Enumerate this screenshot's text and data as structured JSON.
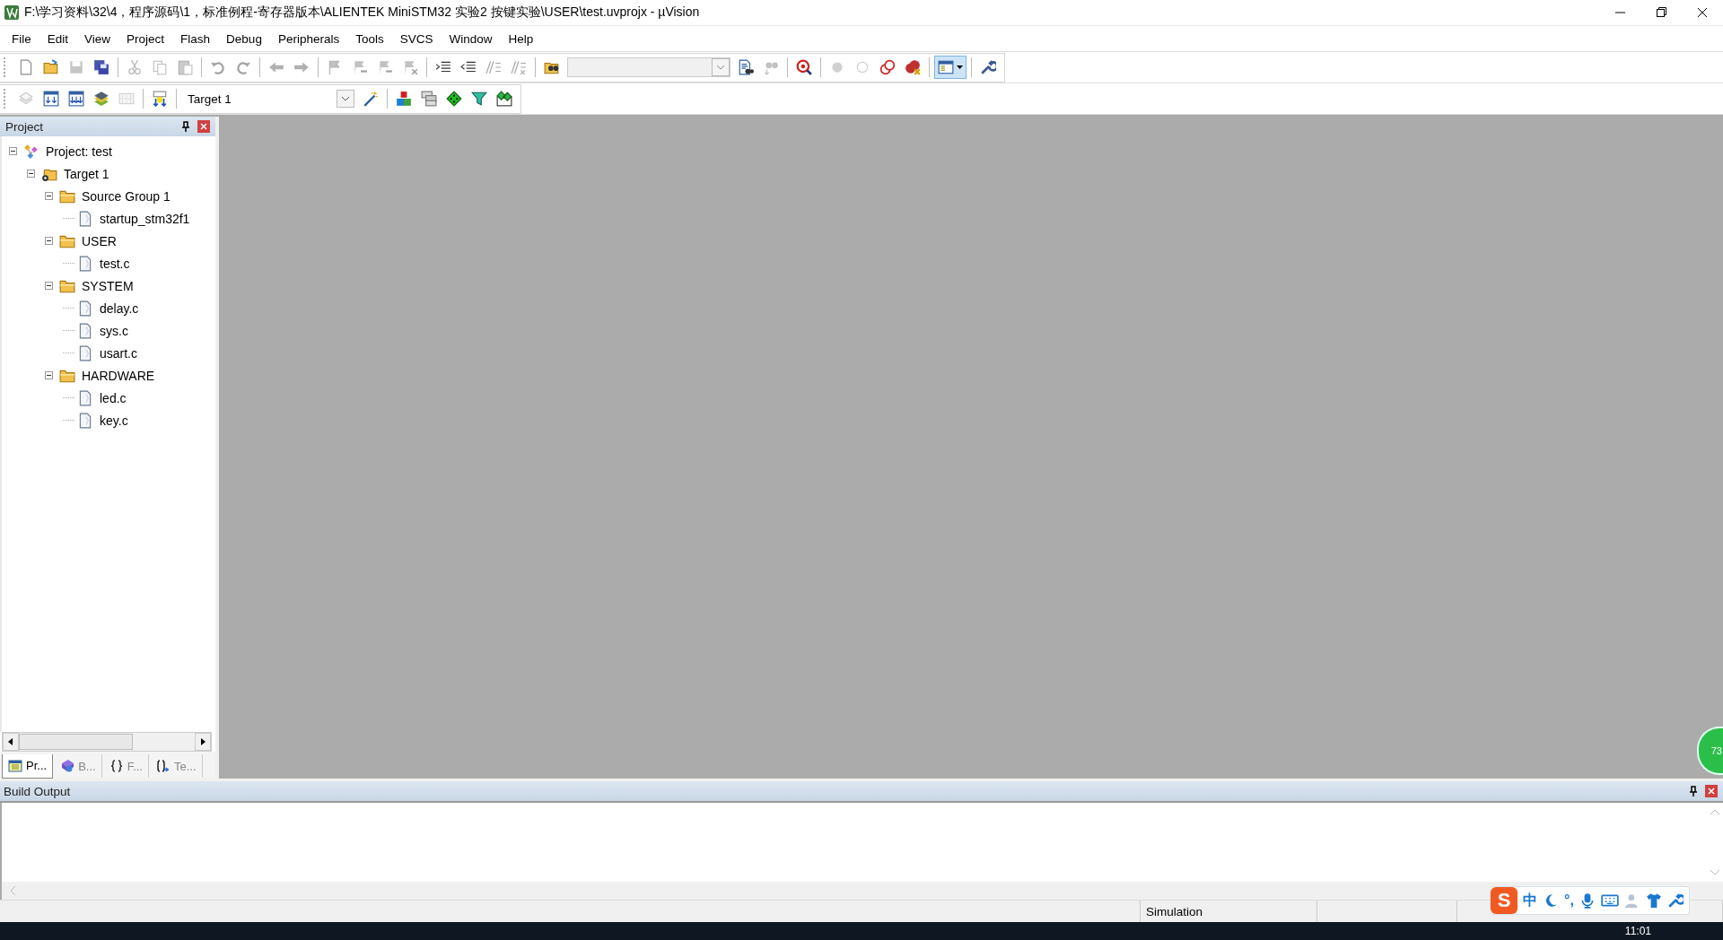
{
  "window": {
    "title": "F:\\学习资料\\32\\4，程序源码\\1，标准例程-寄存器版本\\ALIENTEK MiniSTM32 实验2  按键实验\\USER\\test.uvprojx - µVision"
  },
  "menu": [
    "File",
    "Edit",
    "View",
    "Project",
    "Flash",
    "Debug",
    "Peripherals",
    "Tools",
    "SVCS",
    "Window",
    "Help"
  ],
  "toolbar_1": [
    {
      "kind": "new",
      "disabled": false,
      "pressed": false
    },
    {
      "kind": "open",
      "disabled": false,
      "pressed": false
    },
    {
      "kind": "save",
      "disabled": true,
      "pressed": false
    },
    {
      "kind": "save-all",
      "disabled": false,
      "pressed": false
    },
    {
      "kind": "separator"
    },
    {
      "kind": "cut",
      "disabled": true,
      "pressed": false
    },
    {
      "kind": "copy",
      "disabled": true,
      "pressed": false
    },
    {
      "kind": "paste",
      "disabled": true,
      "pressed": false
    },
    {
      "kind": "separator"
    },
    {
      "kind": "undo",
      "disabled": true,
      "pressed": false
    },
    {
      "kind": "redo",
      "disabled": true,
      "pressed": false
    },
    {
      "kind": "separator"
    },
    {
      "kind": "back",
      "disabled": true,
      "pressed": false
    },
    {
      "kind": "forward",
      "disabled": true,
      "pressed": false
    },
    {
      "kind": "separator"
    },
    {
      "kind": "flag",
      "disabled": true,
      "pressed": false
    },
    {
      "kind": "flag-prev",
      "disabled": true,
      "pressed": false
    },
    {
      "kind": "flag-next",
      "disabled": true,
      "pressed": false
    },
    {
      "kind": "flag-clear",
      "disabled": true,
      "pressed": false
    },
    {
      "kind": "separator"
    },
    {
      "kind": "indent",
      "disabled": false,
      "pressed": false
    },
    {
      "kind": "unindent",
      "disabled": false,
      "pressed": false
    },
    {
      "kind": "comment",
      "disabled": true,
      "pressed": false
    },
    {
      "kind": "uncomment",
      "disabled": true,
      "pressed": false
    },
    {
      "kind": "separator"
    },
    {
      "kind": "find-in-files",
      "disabled": false,
      "pressed": false
    },
    {
      "kind": "combo",
      "disabled": true
    },
    {
      "kind": "find",
      "disabled": false,
      "pressed": false
    },
    {
      "kind": "incremental-find",
      "disabled": true,
      "pressed": false
    },
    {
      "kind": "separator"
    },
    {
      "kind": "debug",
      "disabled": false,
      "pressed": false
    },
    {
      "kind": "separator"
    },
    {
      "kind": "breakpoint",
      "disabled": true,
      "pressed": false
    },
    {
      "kind": "breakpoint-enable",
      "disabled": true,
      "pressed": false
    },
    {
      "kind": "breakpoint-disable-all",
      "disabled": false,
      "pressed": false
    },
    {
      "kind": "breakpoint-kill-all",
      "disabled": false,
      "pressed": false
    },
    {
      "kind": "separator"
    },
    {
      "kind": "window-layout",
      "disabled": false,
      "pressed": true
    },
    {
      "kind": "separator"
    },
    {
      "kind": "wrench",
      "disabled": false,
      "pressed": false
    }
  ],
  "toolbar_2": [
    {
      "kind": "translate",
      "disabled": true
    },
    {
      "kind": "build",
      "disabled": false
    },
    {
      "kind": "rebuild",
      "disabled": false
    },
    {
      "kind": "batch-build",
      "disabled": false
    },
    {
      "kind": "stop",
      "disabled": true
    },
    {
      "kind": "separator"
    },
    {
      "kind": "download",
      "disabled": false
    },
    {
      "kind": "separator"
    },
    {
      "kind": "combo",
      "value": "Target 1",
      "disabled": false
    },
    {
      "kind": "options",
      "disabled": false
    },
    {
      "kind": "separator"
    },
    {
      "kind": "components",
      "disabled": false
    },
    {
      "kind": "environment",
      "disabled": false
    },
    {
      "kind": "diamond",
      "disabled": false
    },
    {
      "kind": "funnel",
      "disabled": false
    },
    {
      "kind": "pack",
      "disabled": false
    }
  ],
  "project_panel": {
    "title": "Project",
    "tree": [
      {
        "label": "Project: test",
        "kind": "project",
        "expanded": true,
        "children": [
          {
            "label": "Target 1",
            "kind": "target",
            "expanded": true,
            "children": [
              {
                "label": "Source Group 1",
                "kind": "group",
                "expanded": true,
                "children": [
                  {
                    "label": "startup_stm32f1",
                    "kind": "file"
                  }
                ]
              },
              {
                "label": "USER",
                "kind": "group",
                "expanded": true,
                "children": [
                  {
                    "label": "test.c",
                    "kind": "file"
                  }
                ]
              },
              {
                "label": "SYSTEM",
                "kind": "group",
                "expanded": true,
                "children": [
                  {
                    "label": "delay.c",
                    "kind": "file"
                  },
                  {
                    "label": "sys.c",
                    "kind": "file"
                  },
                  {
                    "label": "usart.c",
                    "kind": "file"
                  }
                ]
              },
              {
                "label": "HARDWARE",
                "kind": "group",
                "expanded": true,
                "children": [
                  {
                    "label": "led.c",
                    "kind": "file"
                  },
                  {
                    "label": "key.c",
                    "kind": "file"
                  }
                ]
              }
            ]
          }
        ]
      }
    ],
    "tabs": [
      {
        "label": "Pr...",
        "kind": "project",
        "selected": true
      },
      {
        "label": "B...",
        "kind": "books",
        "selected": false
      },
      {
        "label": "F...",
        "kind": "functions",
        "selected": false
      },
      {
        "label": "Te...",
        "kind": "templates",
        "selected": false
      }
    ]
  },
  "build_output": {
    "title": "Build Output"
  },
  "status_bar": {
    "mode": "Simulation"
  },
  "ime_bar": {
    "logo": "S",
    "mode": "中",
    "punctuation": "°,"
  },
  "floating_badge": {
    "text": "73"
  },
  "taskbar": {
    "clock": "11:01"
  }
}
